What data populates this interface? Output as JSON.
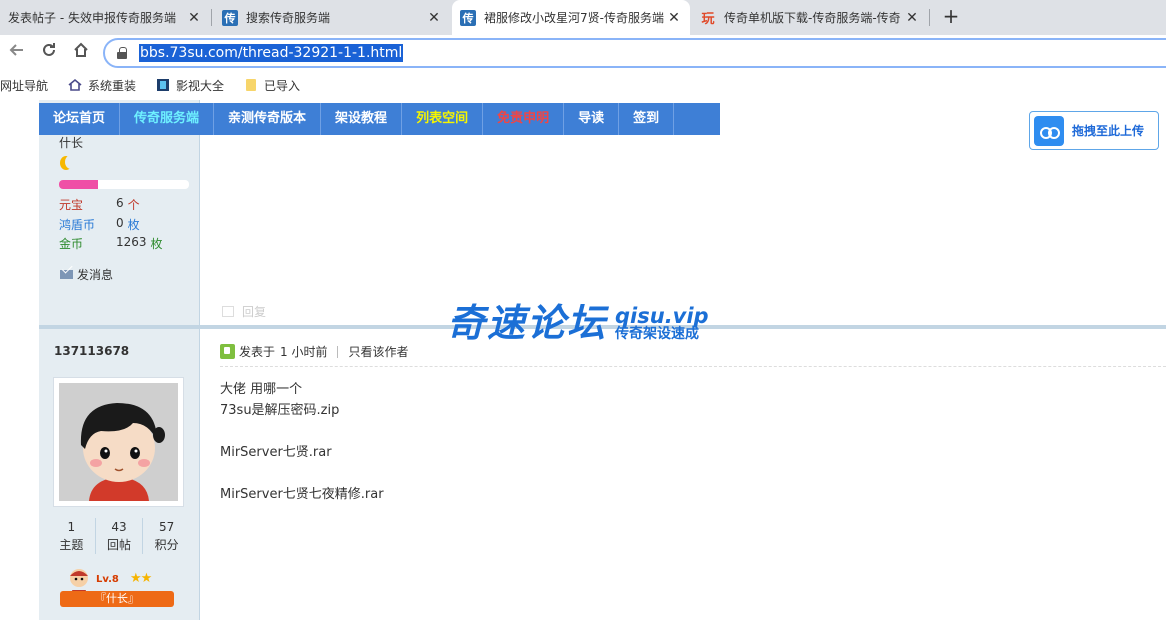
{
  "browser": {
    "tabs": [
      {
        "title": "发表帖子 - 失效申报传奇服务端",
        "favicon": "",
        "active": false
      },
      {
        "title": "搜索传奇服务端",
        "favicon": "传",
        "active": false
      },
      {
        "title": "裙服修改小改星河7贤-传奇服务端",
        "favicon": "传",
        "active": true
      },
      {
        "title": "传奇单机版下载-传奇服务端-传奇",
        "favicon": "玩",
        "active": false
      }
    ],
    "new_tab": "+",
    "close_glyph": "✕",
    "url": "bbs.73su.com/thread-32921-1-1.html",
    "bookmarks": [
      {
        "label": "网址导航",
        "icon": ""
      },
      {
        "label": "系统重装",
        "icon": "home-icon"
      },
      {
        "label": "影视大全",
        "icon": "film-icon"
      },
      {
        "label": "已导入",
        "icon": "folder-icon"
      }
    ]
  },
  "forum": {
    "nav": [
      {
        "label": "论坛首页",
        "color": "white"
      },
      {
        "label": "传奇服务端",
        "color": "cyan"
      },
      {
        "label": "亲测传奇版本",
        "color": "white"
      },
      {
        "label": "架设教程",
        "color": "white"
      },
      {
        "label": "列表空间",
        "color": "yellow"
      },
      {
        "label": "免责申明",
        "color": "red"
      },
      {
        "label": "导读",
        "color": "white"
      },
      {
        "label": "签到",
        "color": "white"
      }
    ],
    "upload_label": "拖拽至此上传",
    "prev_user": {
      "rank": "什长",
      "level_fill": 0.3,
      "stats": [
        {
          "key": "元宝",
          "value": "6",
          "unit": "个",
          "color": "#c0392b"
        },
        {
          "key": "鸿盾币",
          "value": "0",
          "unit": "枚",
          "color": "#2b7bd6"
        },
        {
          "key": "金币",
          "value": "1263",
          "unit": "枚",
          "color": "#2e8b2e"
        }
      ],
      "send_message": "发消息"
    },
    "reply_label": "回复",
    "watermark": {
      "title": "奇速论坛",
      "domain": "qisu.vip",
      "slogan": "传奇架设速成"
    },
    "post": {
      "author": "137113678",
      "posted_label": "发表于",
      "posted_time": "1 小时前",
      "only_author": "只看该作者",
      "body": [
        "大佬  用哪一个",
        "73su是解压密码.zip",
        "",
        "MirServer七贤.rar",
        "",
        "MirServer七贤七夜精修.rar"
      ],
      "author_stats": [
        {
          "value": "1",
          "label": "主题"
        },
        {
          "value": "43",
          "label": "回帖"
        },
        {
          "value": "57",
          "label": "积分"
        }
      ],
      "level_tag": "Lv.8",
      "rank_plate": "『什长』"
    }
  }
}
